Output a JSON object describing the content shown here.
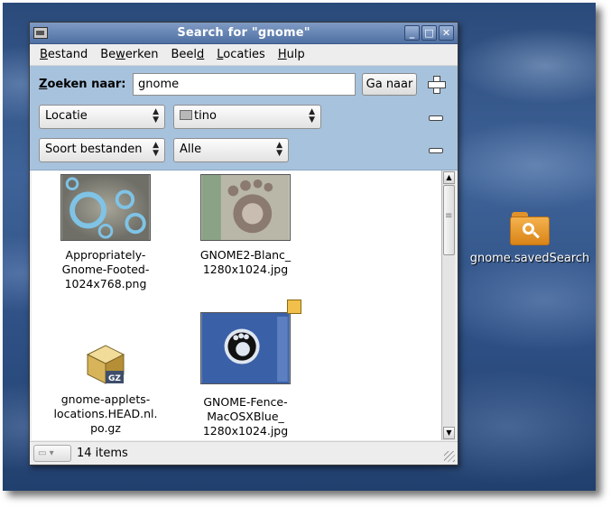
{
  "window": {
    "title": "Search for \"gnome\"",
    "buttons": {
      "minimize": "_",
      "maximize": "□",
      "close": "✕"
    }
  },
  "menubar": {
    "items": [
      {
        "key": "B",
        "rest": "estand"
      },
      {
        "pre": "Be",
        "key": "w",
        "rest": "erken"
      },
      {
        "pre": "Beel",
        "key": "d",
        "rest": ""
      },
      {
        "key": "L",
        "rest": "ocaties"
      },
      {
        "key": "H",
        "rest": "ulp"
      }
    ]
  },
  "search": {
    "label_key": "Z",
    "label_rest": "oeken naar:",
    "query": "gnome",
    "go_button": "Ga naar",
    "rows": [
      {
        "field": "Locatie",
        "value": "tino"
      },
      {
        "field": "Soort bestanden",
        "value": "Alle"
      }
    ]
  },
  "files": [
    {
      "name": "Appropriately-Gnome-Footed-1024x768.png",
      "lines": [
        "Appropriately-",
        "Gnome-Footed-",
        "1024x768.png"
      ]
    },
    {
      "name": "GNOME2-Blanc_1280x1024.jpg",
      "lines": [
        "GNOME2-Blanc_",
        "1280x1024.jpg"
      ]
    },
    {
      "name": "gnome-applets-locations.HEAD.nl.po.gz",
      "lines": [
        "gnome-applets-",
        "locations.HEAD.nl.",
        "po.gz"
      ],
      "badge": "GZ"
    },
    {
      "name": "GNOME-Fence-MacOSXBlue_1280x1024.jpg",
      "lines": [
        "GNOME-Fence-",
        "MacOSXBlue_",
        "1280x1024.jpg"
      ]
    }
  ],
  "statusbar": {
    "count": "14 items"
  },
  "desktop": {
    "icon_label": "gnome.savedSearch"
  }
}
